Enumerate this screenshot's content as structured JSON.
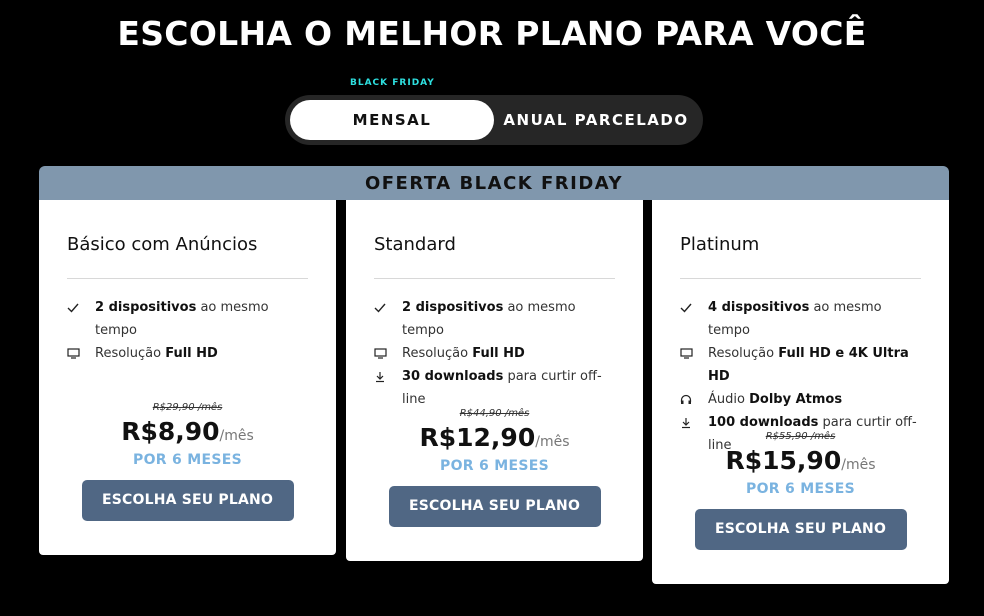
{
  "header": {
    "title": "ESCOLHA O MELHOR PLANO PARA VOCÊ"
  },
  "billing_toggle": {
    "promo_tag": "BLACK FRIDAY",
    "options": [
      {
        "label": "MENSAL",
        "selected": true
      },
      {
        "label": "ANUAL PARCELADO",
        "selected": false
      }
    ]
  },
  "banner": {
    "label": "OFERTA BLACK FRIDAY"
  },
  "plans": [
    {
      "name": "Básico com Anúncios",
      "features": [
        {
          "icon": "check-icon",
          "bold": "2 dispositivos",
          "text": " ao mesmo tempo"
        },
        {
          "icon": "monitor-icon",
          "prefix": "Resolução ",
          "bold": "Full HD",
          "text": ""
        }
      ],
      "old_price": "R$29,90 /mês",
      "price": "R$8,90",
      "per": "/mês",
      "duration": "POR 6 MESES",
      "cta": "ESCOLHA SEU PLANO"
    },
    {
      "name": "Standard",
      "features": [
        {
          "icon": "check-icon",
          "bold": "2 dispositivos",
          "text": " ao mesmo tempo"
        },
        {
          "icon": "monitor-icon",
          "prefix": "Resolução ",
          "bold": "Full HD",
          "text": ""
        },
        {
          "icon": "download-icon",
          "bold": "30 downloads",
          "text": " para curtir off-line"
        }
      ],
      "old_price": "R$44,90 /mês",
      "price": "R$12,90",
      "per": "/mês",
      "duration": "POR 6 MESES",
      "cta": "ESCOLHA SEU PLANO"
    },
    {
      "name": "Platinum",
      "features": [
        {
          "icon": "check-icon",
          "bold": "4 dispositivos",
          "text": " ao mesmo tempo"
        },
        {
          "icon": "monitor-icon",
          "prefix": "Resolução ",
          "bold": "Full HD e 4K Ultra HD",
          "text": ""
        },
        {
          "icon": "headphones-icon",
          "prefix": "Áudio ",
          "bold": "Dolby Atmos",
          "text": ""
        },
        {
          "icon": "download-icon",
          "bold": "100 downloads",
          "text": " para curtir off-line"
        }
      ],
      "old_price": "R$55,90 /mês",
      "price": "R$15,90",
      "per": "/mês",
      "duration": "POR 6 MESES",
      "cta": "ESCOLHA SEU PLANO"
    }
  ],
  "colors": {
    "background": "#000000",
    "banner": "#8097ad",
    "cta": "#506784",
    "duration": "#7ab3e0",
    "promo_tag": "#2ee0e0"
  }
}
